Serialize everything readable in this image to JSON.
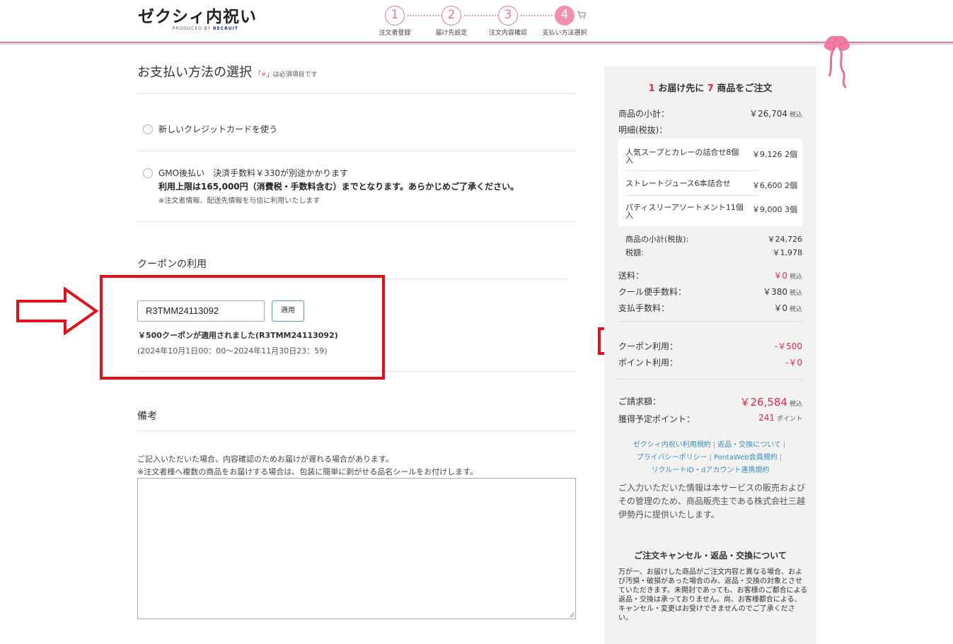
{
  "header": {
    "logo_text": "ゼクシィ内祝い",
    "logo_sub_prefix": "PRODUCED BY",
    "logo_sub_brand": "RECRUIT",
    "steps": [
      {
        "num": "1",
        "label": "注文者登録"
      },
      {
        "num": "2",
        "label": "届け先設定"
      },
      {
        "num": "3",
        "label": "注文内容確認"
      },
      {
        "num": "4",
        "label": "支払い方法選択"
      }
    ]
  },
  "payment": {
    "title": "お支払い方法の選択",
    "req_open": "「",
    "req_mark": "※",
    "req_close": "」は必須項目です",
    "option_credit": "新しいクレジットカードを使う",
    "option_gmo": "GMO後払い　決済手数料￥330が別途かかります",
    "gmo_limit": "利用上限は165,000円（消費税・手数料含む）までとなります。あらかじめご了承ください。",
    "gmo_note": "※注文者情報、配送先情報を与信に利用いたします"
  },
  "coupon": {
    "title": "クーポンの利用",
    "code_value": "R3TMM24113092",
    "apply_label": "適用",
    "applied_msg": "￥500クーポンが適用されました(R3TMM24113092)",
    "period": "(2024年10月1日00：00～2024年11月30日23：59)"
  },
  "remarks": {
    "title": "備考",
    "note1": "ご記入いただいた場合、内容確認のためお届けが遅れる場合があります。",
    "note2": "※注文者様へ複数の商品をお届けする場合は、包装に簡単に剥がせる品名シールをお付けします。",
    "value": ""
  },
  "summary": {
    "dest_count": "1",
    "title_mid": "お届け先に",
    "item_count": "7",
    "title_end": "商品をご注文",
    "subtotal_label": "商品の小計：",
    "subtotal_value": "￥26,704",
    "tax_incl": "税込",
    "detail_label": "明細(税抜)：",
    "items": [
      {
        "name": "人気スープとカレーの詰合せ8個入",
        "price": "￥9,126",
        "qty": "2個"
      },
      {
        "name": "ストレートジュース6本詰合せ",
        "price": "￥6,600",
        "qty": "2個"
      },
      {
        "name": "パティスリーアソートメント11個入",
        "price": "￥9,000",
        "qty": "3個"
      }
    ],
    "subtotal_ex_label": "商品の小計(税抜):",
    "subtotal_ex_value": "￥24,726",
    "tax_label": "税額:",
    "tax_value": "￥1,978",
    "shipping_label": "送料：",
    "shipping_value": "￥0",
    "cool_label": "クール便手数料：",
    "cool_value": "￥380",
    "payfee_label": "支払手数料：",
    "payfee_value": "￥0",
    "coupon_label": "クーポン利用：",
    "coupon_value": "-￥500",
    "point_label": "ポイント利用：",
    "point_value": "-￥0",
    "billing_label": "ご請求額：",
    "billing_value": "￥26,584",
    "earn_label": "獲得予定ポイント：",
    "earn_value": "241",
    "earn_unit": "ポイント",
    "links": [
      "ゼクシィ内祝い利用規約",
      "返品・交換について",
      "プライバシーポリシー",
      "PontaWeb会員規約",
      "リクルートID・dアカウント連携規約"
    ],
    "privacy_text": "ご入力いただいた情報は本サービスの販売およびその管理のため、商品販売主である株式会社三越伊勢丹に提供いたします。",
    "cancel_title": "ご注文キャンセル・返品・交換について",
    "cancel_text": "万が一、お届けした商品がご注文内容と異なる場合、および汚損・破損があった場合のみ、返品・交換の対象とさせていただきます。未開封であっても、お客様のご都合による返品・交換は承っておりません。尚、お客様都合による、キャンセル・変更はお受けできませんのでご了承ください。"
  },
  "colors": {
    "accent_pink": "#ec6f9a",
    "price_pink": "#e0294f",
    "highlight_red": "#e3101c",
    "link_blue": "#3b8fb6"
  }
}
